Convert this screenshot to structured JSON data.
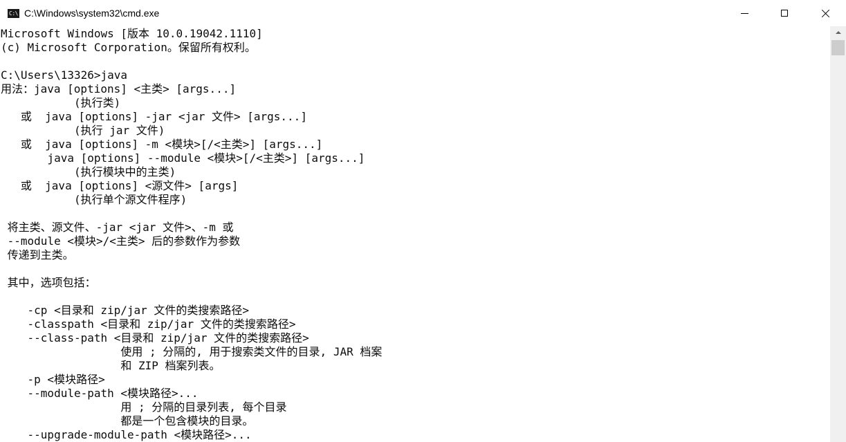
{
  "window": {
    "title": "C:\\Windows\\system32\\cmd.exe",
    "icon_label": "C:\\"
  },
  "console": {
    "lines": [
      "Microsoft Windows [版本 10.0.19042.1110]",
      "(c) Microsoft Corporation。保留所有权利。",
      "",
      "C:\\Users\\13326>java",
      "用法：java [options] <主类> [args...]",
      "           (执行类)",
      "   或  java [options] -jar <jar 文件> [args...]",
      "           (执行 jar 文件)",
      "   或  java [options] -m <模块>[/<主类>] [args...]",
      "       java [options] --module <模块>[/<主类>] [args...]",
      "           (执行模块中的主类)",
      "   或  java [options] <源文件> [args]",
      "           (执行单个源文件程序)",
      "",
      " 将主类、源文件、-jar <jar 文件>、-m 或",
      " --module <模块>/<主类> 后的参数作为参数",
      " 传递到主类。",
      "",
      " 其中，选项包括：",
      "",
      "    -cp <目录和 zip/jar 文件的类搜索路径>",
      "    -classpath <目录和 zip/jar 文件的类搜索路径>",
      "    --class-path <目录和 zip/jar 文件的类搜索路径>",
      "                  使用 ; 分隔的, 用于搜索类文件的目录, JAR 档案",
      "                  和 ZIP 档案列表。",
      "    -p <模块路径>",
      "    --module-path <模块路径>...",
      "                  用 ; 分隔的目录列表, 每个目录",
      "                  都是一个包含模块的目录。",
      "    --upgrade-module-path <模块路径>..."
    ]
  },
  "colors": {
    "background": "#ffffff",
    "text": "#0c0c0c",
    "scrollbar": "#f0f0f0",
    "scroll_thumb": "#cdcdcd"
  },
  "icons": {
    "app": "cmd-app-icon",
    "minimize": "minimize-icon",
    "maximize": "maximize-icon",
    "close": "close-icon",
    "scroll_up": "scroll-up-arrow-icon"
  }
}
